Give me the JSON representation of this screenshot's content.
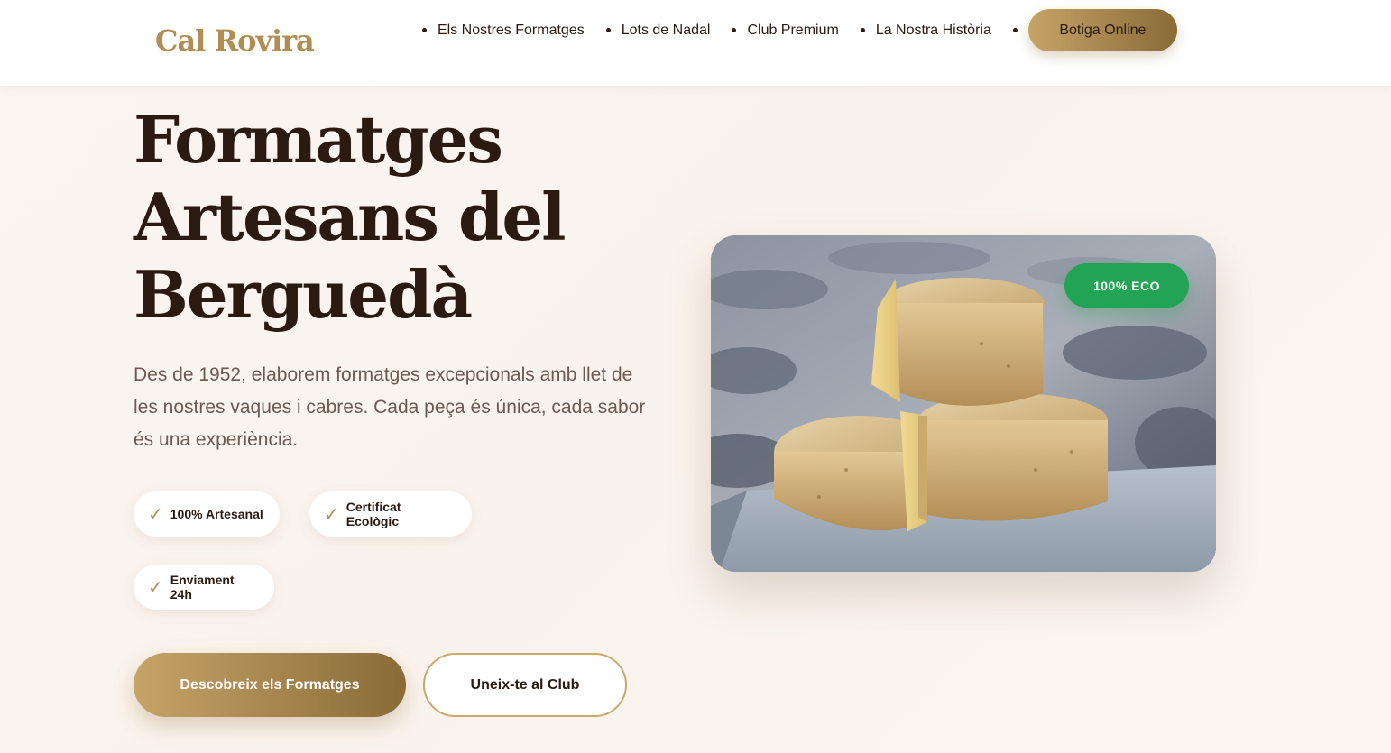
{
  "brand": {
    "name": "Cal Rovira"
  },
  "nav": {
    "items": [
      {
        "label": "Els Nostres Formatges"
      },
      {
        "label": "Lots de Nadal"
      },
      {
        "label": "Club Premium"
      },
      {
        "label": "La Nostra Història"
      }
    ],
    "cta_label": "Botiga Online"
  },
  "hero": {
    "title_lines": [
      "Formatges",
      "Artesans del",
      "Berguedà"
    ],
    "description": "Des de 1952, elaborem formatges excepcionals amb llet de les nostres vaques i cabres. Cada peça és única, cada sabor és una experiència.",
    "features": [
      {
        "label": "100% Artesanal"
      },
      {
        "label": "Certificat Ecològic"
      },
      {
        "label": "Enviament 24h"
      }
    ],
    "check_icon": "checkmark-icon",
    "primary_button": "Descobreix els Formatges",
    "secondary_button": "Uneix-te al Club",
    "image_badge": "100% ECO"
  },
  "colors": {
    "gold_accent": "#b08d52",
    "gold_gradient_start": "#c6a468",
    "gold_gradient_end": "#8a6a36",
    "eco_green": "#23a356",
    "text_dark": "#2a1a12",
    "text_muted": "#6a5a52",
    "background": "#fbf5ef"
  }
}
